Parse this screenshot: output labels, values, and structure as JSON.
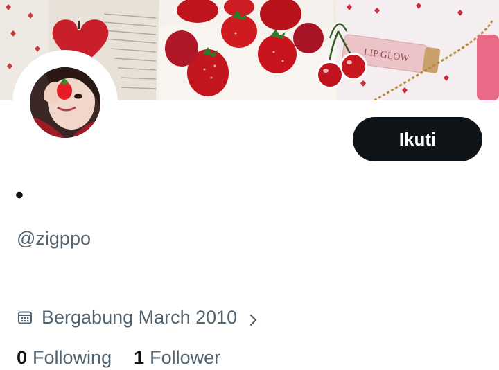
{
  "profile": {
    "display_name": "•",
    "handle": "@zigppo",
    "follow_label": "Ikuti",
    "joined_text": "Bergabung March 2010",
    "banner_lipgloss_text": "LIP GLOW"
  },
  "stats": {
    "following_count": "0",
    "following_label": "Following",
    "followers_count": "1",
    "followers_label": "Follower"
  },
  "icons": {
    "joined": "calendar-icon",
    "joined_more": "chevron-right-icon"
  },
  "colors": {
    "button_bg": "#0f1419",
    "secondary_text": "#536471"
  }
}
